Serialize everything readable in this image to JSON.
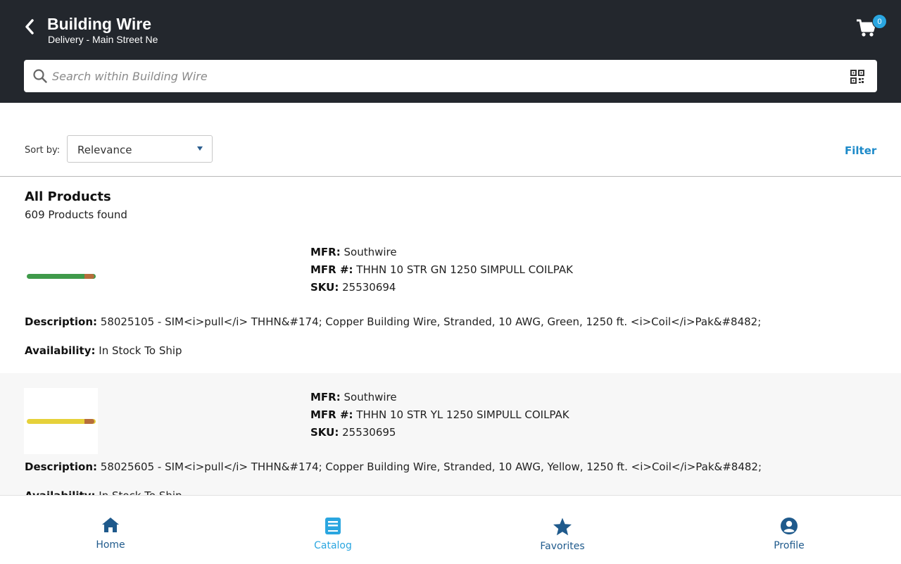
{
  "header": {
    "title": "Building Wire",
    "subtitle": "Delivery - Main Street Ne",
    "cart_count": "0"
  },
  "search": {
    "placeholder": "Search within Building Wire"
  },
  "sort": {
    "label": "Sort by:",
    "value": "Relevance",
    "filter_label": "Filter"
  },
  "results": {
    "title": "All Products",
    "count": "609 Products found"
  },
  "labels": {
    "mfr": "MFR:",
    "mfr_num": "MFR #:",
    "sku": "SKU:",
    "description": "Description:",
    "availability": "Availability:"
  },
  "products": [
    {
      "mfr": "Southwire",
      "mfr_num": "THHN 10 STR GN 1250 SIMPULL COILPAK",
      "sku": "25530694",
      "description": "58025105 - SIM<i>pull</i> THHN&#174; Copper Building Wire, Stranded, 10 AWG, Green, 1250 ft. <i>Coil</i>Pak&#8482;",
      "availability": "In Stock To Ship",
      "wire_color": "#3f9a4a"
    },
    {
      "mfr": "Southwire",
      "mfr_num": "THHN 10 STR YL 1250 SIMPULL COILPAK",
      "sku": "25530695",
      "description": "58025605 - SIM<i>pull</i> THHN&#174; Copper Building Wire, Stranded, 10 AWG, Yellow, 1250 ft. <i>Coil</i>Pak&#8482;",
      "availability": "In Stock To Ship",
      "wire_color": "#e6d13a"
    }
  ],
  "nav": [
    {
      "label": "Home",
      "icon": "home-icon",
      "color": "#1f5a8c"
    },
    {
      "label": "Catalog",
      "icon": "catalog-icon",
      "color": "#2aa6e0"
    },
    {
      "label": "Favorites",
      "icon": "star-icon",
      "color": "#1f5a8c"
    },
    {
      "label": "Profile",
      "icon": "profile-icon",
      "color": "#1f5a8c"
    }
  ]
}
